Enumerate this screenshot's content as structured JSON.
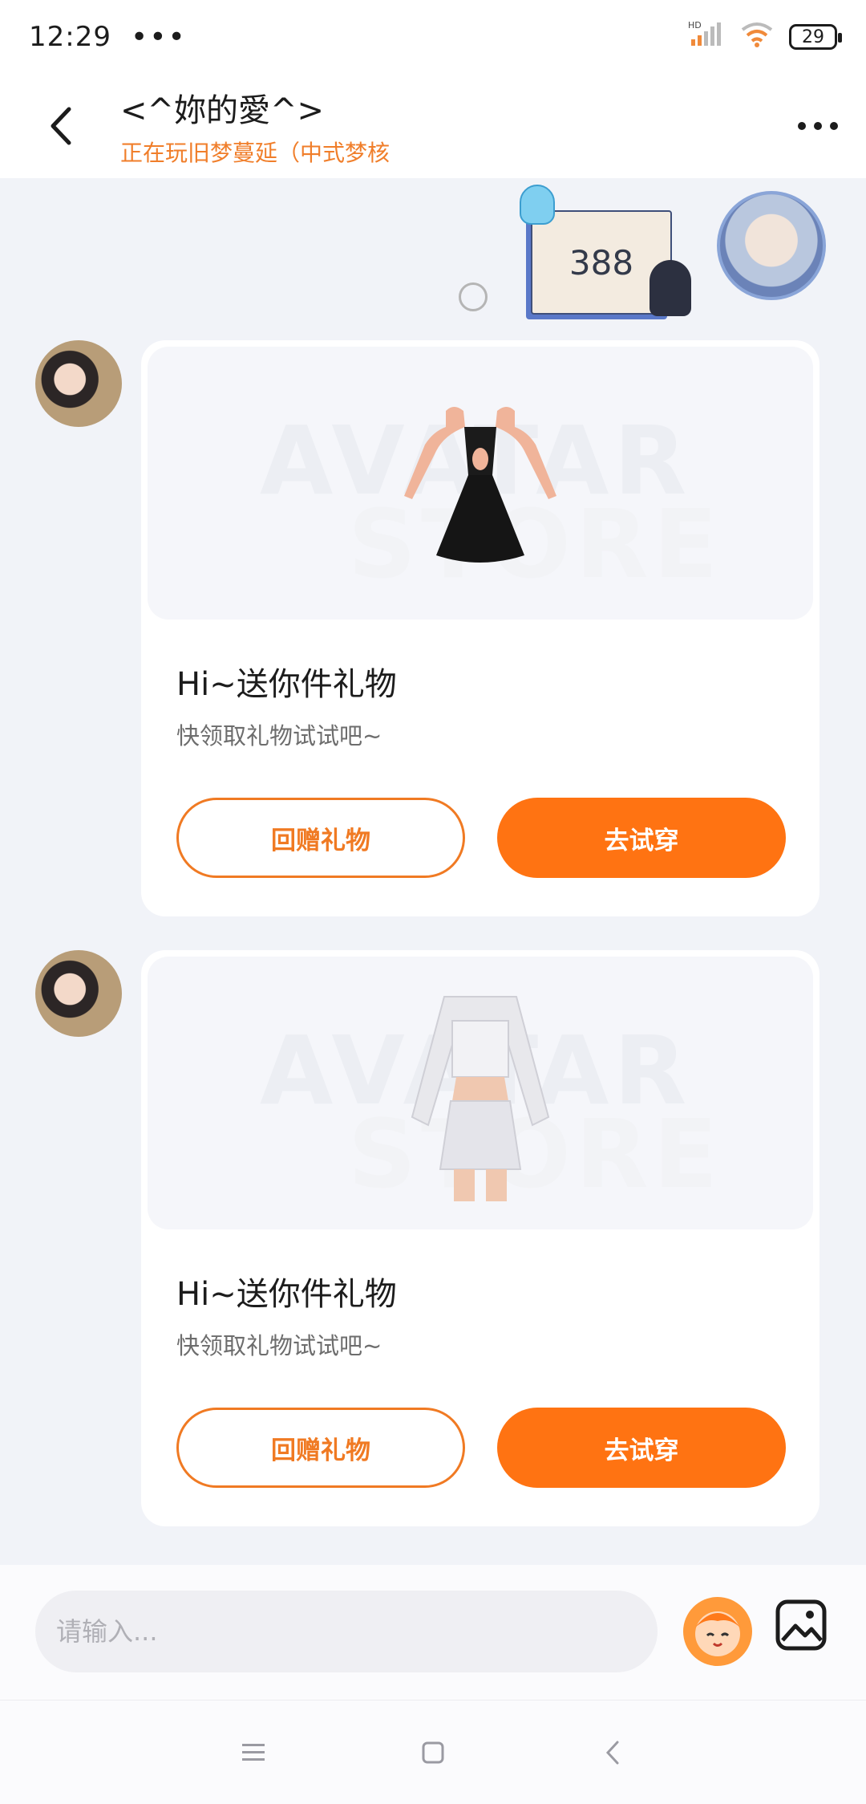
{
  "status_bar": {
    "time": "12:29",
    "dots": "•••",
    "network": "HD",
    "battery": "29"
  },
  "header": {
    "title": "<^妳的愛^>",
    "subtitle": "正在玩旧梦蔓延（中式梦核"
  },
  "gift_badge": {
    "count": "388"
  },
  "watermark": {
    "line1": "AVATAR",
    "line2": "STORE"
  },
  "messages": [
    {
      "title": "Hi~送你件礼物",
      "desc": "快领取礼物试试吧~",
      "return_label": "回赠礼物",
      "try_label": "去试穿",
      "garment": "black-halter-dress"
    },
    {
      "title": "Hi~送你件礼物",
      "desc": "快领取礼物试试吧~",
      "return_label": "回赠礼物",
      "try_label": "去试穿",
      "garment": "white-crop-top-skirt"
    }
  ],
  "input": {
    "placeholder": "请输入..."
  },
  "colors": {
    "accent": "#ff7312",
    "subtitle": "#f07e2a",
    "background": "#f1f3f8"
  }
}
